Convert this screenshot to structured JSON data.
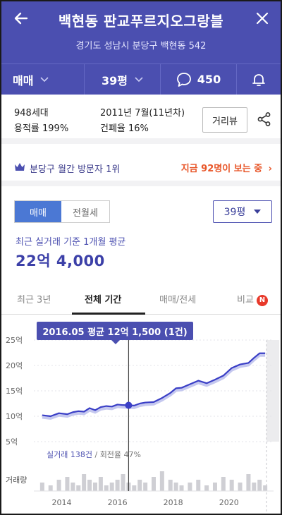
{
  "header": {
    "title": "백현동 판교푸르지오그랑블",
    "address": "경기도 성남시 분당구 백현동 542"
  },
  "tabs": {
    "deal_type": "매매",
    "size": "39평",
    "comments": "450"
  },
  "info": {
    "households": "948세대",
    "floor_area_ratio": "용적률 199%",
    "built": "2011년 7월(11년차)",
    "coverage_ratio": "건폐율 16%",
    "street_view": "거리뷰"
  },
  "visitors": {
    "rank": "분당구 월간 방문자 1위",
    "now_viewing": "지금 92명이 보는 중"
  },
  "price_section": {
    "seg_sale": "매매",
    "seg_rent": "전월세",
    "size_select": "39평",
    "basis": "최근 실거래 기준 1개월 평균",
    "price": "22억 4,000"
  },
  "period_tabs": [
    {
      "label": "최근 3년",
      "active": false
    },
    {
      "label": "전체 기간",
      "active": true
    },
    {
      "label": "매매/전세",
      "active": false
    },
    {
      "label": "비교",
      "active": false,
      "badge": "N"
    }
  ],
  "chart_data": {
    "type": "line",
    "tooltip": "2016.05 평균 12억 1,500 (1건)",
    "y_ticks": [
      "25억",
      "20억",
      "15억",
      "10억",
      "5억"
    ],
    "x_ticks": [
      "2014",
      "2016",
      "2018",
      "2020"
    ],
    "ylim": [
      5,
      25
    ],
    "xlim": [
      2013,
      2021.6
    ],
    "x": [
      2013.3,
      2013.6,
      2013.9,
      2014.2,
      2014.4,
      2014.6,
      2014.8,
      2015.0,
      2015.2,
      2015.4,
      2015.6,
      2015.8,
      2016.0,
      2016.2,
      2016.4,
      2016.6,
      2016.8,
      2017.0,
      2017.3,
      2017.6,
      2017.9,
      2018.1,
      2018.3,
      2018.6,
      2018.9,
      2019.2,
      2019.5,
      2019.8,
      2020.1,
      2020.4,
      2020.7,
      2020.9,
      2021.1,
      2021.3
    ],
    "values": [
      10.2,
      10.0,
      10.6,
      10.4,
      10.8,
      11.0,
      10.9,
      11.6,
      11.2,
      11.8,
      12.0,
      11.9,
      12.3,
      12.2,
      12.15,
      12.1,
      12.5,
      12.7,
      12.8,
      13.6,
      14.6,
      15.5,
      15.6,
      16.3,
      17.0,
      16.5,
      17.2,
      18.0,
      19.5,
      20.2,
      20.5,
      21.5,
      22.4,
      22.4
    ],
    "highlight": {
      "x": 2016.4,
      "y": 12.15
    },
    "volume": [
      3,
      2,
      4,
      5,
      3,
      2,
      6,
      4,
      3,
      5,
      2,
      3,
      4,
      6,
      3,
      2,
      4,
      3,
      5,
      7,
      4,
      3,
      2,
      3,
      4,
      2,
      3,
      5,
      4,
      3,
      6,
      3,
      4,
      2
    ],
    "volume_label": "거래량",
    "trade_count": "실거래 138건",
    "turnover": "회전율 47%"
  }
}
